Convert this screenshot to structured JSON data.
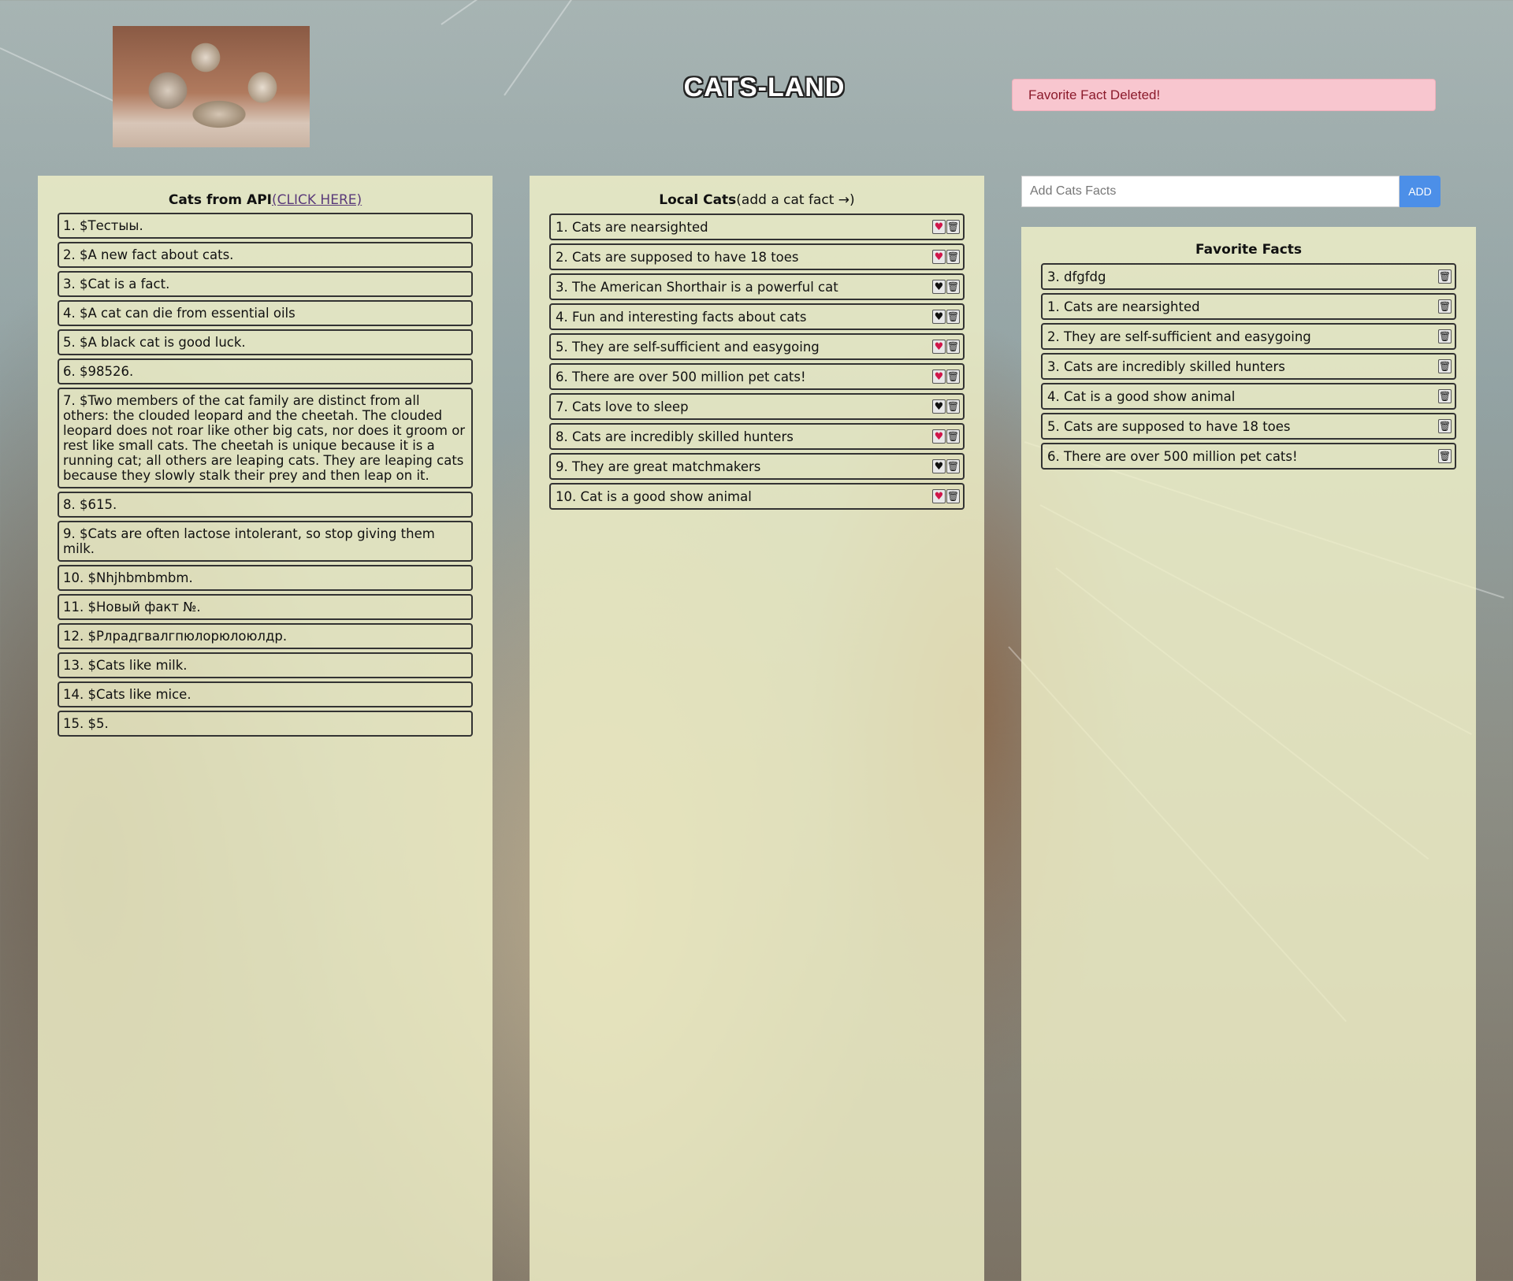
{
  "header": {
    "logo_alt": "cats logo",
    "title": "CATS-LAND",
    "alert": "Favorite Fact Deleted!"
  },
  "api_panel": {
    "title": "Cats from API",
    "link": "(CLICK HERE)",
    "items": [
      "1. $Тестыы.",
      "2. $A new fact about cats.",
      "3. $Cat is a fact.",
      "4. $A cat can die from essential oils",
      "5. $A black cat is good luck.",
      "6. $98526.",
      "7. $Two members of the cat family are distinct from all others: the clouded leopard and the cheetah. The clouded leopard does not roar like other big cats, nor does it groom or rest like small cats. The cheetah is unique because it is a running cat; all others are leaping cats. They are leaping cats because they slowly stalk their prey and then leap on it.",
      "8. $615.",
      "9. $Cats are often lactose intolerant, so stop giving them milk.",
      "10. $Nhjhbmbmbm.",
      "11. $Новый факт №.",
      "12. $Рлрадгвалгпюлорюлоюлдр.",
      "13. $Cats like milk.",
      "14. $Cats like mice.",
      "15. $5."
    ]
  },
  "local_panel": {
    "title": "Local Cats",
    "subtitle": "(add a cat fact →)",
    "items": [
      {
        "text": "1. Cats are nearsighted",
        "fav": true
      },
      {
        "text": "2. Cats are supposed to have 18 toes",
        "fav": true
      },
      {
        "text": "3. The American Shorthair is a powerful cat",
        "fav": false
      },
      {
        "text": "4. Fun and interesting facts about cats",
        "fav": false
      },
      {
        "text": "5. They are self-sufficient and easygoing",
        "fav": true
      },
      {
        "text": "6. There are over 500 million pet cats!",
        "fav": true
      },
      {
        "text": "7. Cats love to sleep",
        "fav": false
      },
      {
        "text": "8. Cats are incredibly skilled hunters",
        "fav": true
      },
      {
        "text": "9. They are great matchmakers",
        "fav": false
      },
      {
        "text": "10. Cat is a good show animal",
        "fav": true
      }
    ]
  },
  "add_form": {
    "placeholder": "Add Cats Facts",
    "button": "ADD"
  },
  "favorites_panel": {
    "title": "Favorite Facts",
    "items": [
      "3. dfgfdg",
      "1. Cats are nearsighted",
      "2. They are self-sufficient and easygoing",
      "3. Cats are incredibly skilled hunters",
      "4. Cat is a good show animal",
      "5. Cats are supposed to have 18 toes",
      "6. There are over 500 million pet cats!"
    ]
  },
  "icons": {
    "heart": "heart-icon",
    "trash": "trash-icon"
  },
  "colors": {
    "alert_bg": "#f8c6cf",
    "alert_text": "#8b1a2b",
    "panel_bg": "#f0f0c8",
    "add_button": "#4c8fe8",
    "heart_fav": "#d0174a",
    "heart_plain": "#111111"
  }
}
